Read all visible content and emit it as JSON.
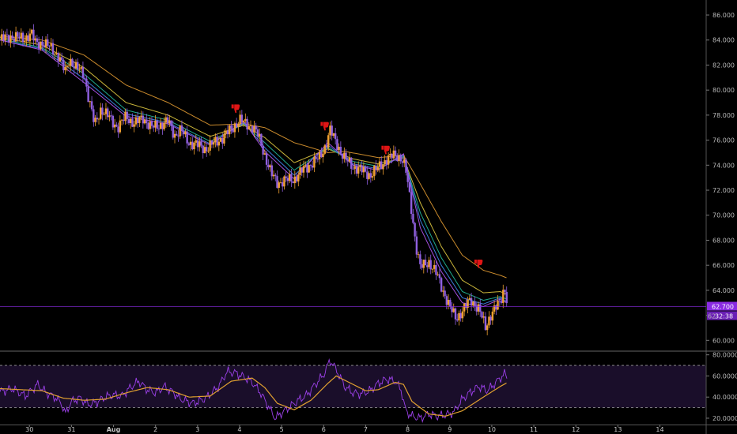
{
  "chart_data": [
    {
      "type": "candlestick",
      "ylim": [
        59.2,
        87.2
      ],
      "y_ticks": [
        "86.000",
        "84.000",
        "82.000",
        "80.000",
        "78.000",
        "76.000",
        "74.000",
        "72.000",
        "70.000",
        "68.000",
        "66.000",
        "64.000",
        "62.000",
        "60.000"
      ],
      "y_tick_values": [
        86,
        84,
        82,
        80,
        78,
        76,
        74,
        72,
        70,
        68,
        66,
        64,
        62,
        60
      ],
      "x_ticks": [
        {
          "label": "30",
          "t": 0.7
        },
        {
          "label": "31",
          "t": 1.7
        },
        {
          "label": "Aug",
          "t": 2.7,
          "bold": true
        },
        {
          "label": "2",
          "t": 3.7
        },
        {
          "label": "3",
          "t": 4.7
        },
        {
          "label": "4",
          "t": 5.7
        },
        {
          "label": "5",
          "t": 6.7
        },
        {
          "label": "6",
          "t": 7.7
        },
        {
          "label": "7",
          "t": 8.7
        },
        {
          "label": "8",
          "t": 9.7
        },
        {
          "label": "9",
          "t": 10.7
        },
        {
          "label": "10",
          "t": 11.7
        },
        {
          "label": "11",
          "t": 12.7
        },
        {
          "label": "12",
          "t": 13.7
        },
        {
          "label": "13",
          "t": 14.7
        },
        {
          "label": "14",
          "t": 15.7
        }
      ],
      "x_range": [
        0,
        16.8
      ],
      "last_price": {
        "label": "62.700",
        "value": 62.7,
        "countdown": "32:38",
        "partial": "62"
      },
      "price_path": [
        [
          0,
          84.0
        ],
        [
          0.25,
          84.3
        ],
        [
          0.55,
          84.1
        ],
        [
          0.75,
          84.5
        ],
        [
          0.85,
          83.7
        ],
        [
          1.0,
          83.8
        ],
        [
          1.2,
          83.4
        ],
        [
          1.4,
          82.7
        ],
        [
          1.55,
          81.4
        ],
        [
          1.65,
          82.5
        ],
        [
          1.8,
          81.8
        ],
        [
          2.0,
          81.3
        ],
        [
          2.1,
          79.5
        ],
        [
          2.25,
          77.2
        ],
        [
          2.4,
          78.5
        ],
        [
          2.6,
          77.8
        ],
        [
          2.8,
          77.0
        ],
        [
          3.0,
          77.9
        ],
        [
          3.2,
          77.3
        ],
        [
          3.4,
          77.8
        ],
        [
          3.6,
          77.0
        ],
        [
          3.8,
          77.2
        ],
        [
          4.0,
          77.5
        ],
        [
          4.15,
          76.4
        ],
        [
          4.3,
          76.8
        ],
        [
          4.5,
          75.8
        ],
        [
          4.7,
          75.6
        ],
        [
          4.9,
          75.3
        ],
        [
          5.1,
          75.8
        ],
        [
          5.3,
          76.2
        ],
        [
          5.5,
          76.9
        ],
        [
          5.7,
          77.6
        ],
        [
          5.85,
          77.3
        ],
        [
          6.0,
          77.1
        ],
        [
          6.15,
          76.3
        ],
        [
          6.3,
          74.8
        ],
        [
          6.45,
          73.3
        ],
        [
          6.6,
          72.6
        ],
        [
          6.8,
          72.8
        ],
        [
          7.0,
          72.9
        ],
        [
          7.2,
          73.6
        ],
        [
          7.4,
          74.1
        ],
        [
          7.6,
          74.6
        ],
        [
          7.75,
          75.6
        ],
        [
          7.85,
          76.8
        ],
        [
          8.0,
          75.8
        ],
        [
          8.2,
          74.5
        ],
        [
          8.4,
          73.9
        ],
        [
          8.6,
          73.6
        ],
        [
          8.8,
          73.2
        ],
        [
          9.0,
          73.8
        ],
        [
          9.2,
          74.5
        ],
        [
          9.4,
          74.8
        ],
        [
          9.55,
          74.6
        ],
        [
          9.65,
          73.7
        ],
        [
          9.8,
          70.2
        ],
        [
          9.9,
          67.5
        ],
        [
          10.0,
          65.8
        ],
        [
          10.2,
          66.3
        ],
        [
          10.4,
          65.2
        ],
        [
          10.55,
          63.9
        ],
        [
          10.7,
          62.6
        ],
        [
          10.85,
          61.8
        ],
        [
          11.0,
          62.3
        ],
        [
          11.2,
          63.3
        ],
        [
          11.4,
          62.4
        ],
        [
          11.55,
          61.1
        ],
        [
          11.65,
          61.9
        ],
        [
          11.8,
          62.6
        ],
        [
          11.9,
          63.1
        ],
        [
          12.0,
          64.3
        ],
        [
          12.08,
          62.8
        ]
      ],
      "ema_series": [
        {
          "color": "#c98a2c",
          "points": [
            [
              0,
              84.3
            ],
            [
              1.0,
              84.0
            ],
            [
              2.0,
              82.8
            ],
            [
              3.0,
              80.4
            ],
            [
              4.0,
              79.0
            ],
            [
              5.0,
              77.2
            ],
            [
              5.8,
              77.3
            ],
            [
              6.3,
              77.0
            ],
            [
              7.0,
              75.8
            ],
            [
              7.8,
              75.0
            ],
            [
              8.2,
              75.1
            ],
            [
              9.0,
              74.6
            ],
            [
              9.6,
              74.8
            ],
            [
              10.0,
              72.5
            ],
            [
              10.5,
              69.5
            ],
            [
              11.0,
              66.8
            ],
            [
              11.5,
              65.6
            ],
            [
              11.9,
              65.2
            ],
            [
              12.05,
              65.0
            ]
          ]
        },
        {
          "color": "#c9b53a",
          "points": [
            [
              0,
              84.2
            ],
            [
              1.0,
              83.6
            ],
            [
              2.0,
              81.8
            ],
            [
              3.0,
              79.0
            ],
            [
              4.0,
              78.0
            ],
            [
              5.0,
              76.3
            ],
            [
              5.8,
              77.2
            ],
            [
              6.3,
              76.2
            ],
            [
              7.0,
              74.2
            ],
            [
              7.8,
              75.3
            ],
            [
              8.4,
              74.5
            ],
            [
              9.0,
              74.1
            ],
            [
              9.6,
              74.6
            ],
            [
              10.0,
              71.0
            ],
            [
              10.5,
              67.5
            ],
            [
              11.0,
              64.8
            ],
            [
              11.5,
              63.8
            ],
            [
              11.9,
              63.9
            ],
            [
              12.05,
              63.7
            ]
          ]
        },
        {
          "color": "#1faa8c",
          "points": [
            [
              0,
              84.1
            ],
            [
              1.0,
              83.4
            ],
            [
              2.0,
              81.3
            ],
            [
              3.0,
              78.4
            ],
            [
              4.0,
              77.6
            ],
            [
              5.0,
              75.9
            ],
            [
              5.8,
              77.3
            ],
            [
              6.3,
              75.8
            ],
            [
              7.0,
              73.6
            ],
            [
              7.8,
              75.4
            ],
            [
              8.4,
              74.3
            ],
            [
              9.0,
              73.9
            ],
            [
              9.6,
              74.7
            ],
            [
              10.0,
              70.2
            ],
            [
              10.5,
              66.6
            ],
            [
              11.0,
              63.9
            ],
            [
              11.5,
              63.2
            ],
            [
              11.9,
              63.5
            ],
            [
              12.05,
              63.3
            ]
          ]
        },
        {
          "color": "#3b7bd9",
          "points": [
            [
              0,
              84.0
            ],
            [
              1.0,
              83.3
            ],
            [
              2.0,
              80.9
            ],
            [
              3.0,
              78.1
            ],
            [
              4.0,
              77.4
            ],
            [
              5.0,
              75.7
            ],
            [
              5.8,
              77.4
            ],
            [
              6.3,
              75.4
            ],
            [
              7.0,
              73.2
            ],
            [
              7.8,
              75.6
            ],
            [
              8.4,
              74.1
            ],
            [
              9.0,
              73.7
            ],
            [
              9.6,
              74.8
            ],
            [
              10.0,
              69.6
            ],
            [
              10.5,
              66.0
            ],
            [
              11.0,
              63.4
            ],
            [
              11.5,
              62.9
            ],
            [
              11.9,
              63.4
            ],
            [
              12.05,
              63.1
            ]
          ]
        },
        {
          "color": "#a54fe0",
          "points": [
            [
              0,
              84.0
            ],
            [
              1.0,
              83.2
            ],
            [
              2.0,
              80.6
            ],
            [
              3.0,
              77.9
            ],
            [
              4.0,
              77.3
            ],
            [
              5.0,
              75.6
            ],
            [
              5.8,
              77.5
            ],
            [
              6.3,
              75.1
            ],
            [
              7.0,
              72.9
            ],
            [
              7.8,
              75.8
            ],
            [
              8.4,
              74.0
            ],
            [
              9.0,
              73.6
            ],
            [
              9.6,
              74.9
            ],
            [
              10.0,
              69.0
            ],
            [
              10.5,
              65.5
            ],
            [
              11.0,
              63.0
            ],
            [
              11.5,
              62.7
            ],
            [
              11.9,
              63.3
            ],
            [
              12.05,
              63.0
            ]
          ]
        }
      ],
      "sell_signals": [
        {
          "t": 5.6,
          "value": 78.6
        },
        {
          "t": 7.72,
          "value": 77.2
        },
        {
          "t": 9.17,
          "value": 75.3
        },
        {
          "t": 11.38,
          "value": 66.2
        }
      ],
      "colors": {
        "bull": "#f0a030",
        "bear": "#9060e0",
        "background": "#000000",
        "grid": "#3a3a3a",
        "price_line": "#8a2be2",
        "signal": "#e01515"
      }
    },
    {
      "type": "line",
      "ylim": [
        14,
        82
      ],
      "y_ticks": [
        "80.0000",
        "60.0000",
        "40.0000",
        "20.0000"
      ],
      "y_tick_values": [
        80,
        60,
        40,
        20
      ],
      "band": [
        30,
        70
      ],
      "series": [
        {
          "color": "#9b40e8",
          "points": [
            [
              0,
              45
            ],
            [
              0.3,
              48
            ],
            [
              0.6,
              41
            ],
            [
              0.9,
              52
            ],
            [
              1.1,
              44
            ],
            [
              1.3,
              40
            ],
            [
              1.45,
              35
            ],
            [
              1.55,
              24
            ],
            [
              1.7,
              36
            ],
            [
              1.9,
              39
            ],
            [
              2.1,
              33
            ],
            [
              2.3,
              35
            ],
            [
              2.5,
              40
            ],
            [
              2.7,
              42
            ],
            [
              2.9,
              41
            ],
            [
              3.1,
              49
            ],
            [
              3.3,
              55
            ],
            [
              3.5,
              47
            ],
            [
              3.7,
              44
            ],
            [
              3.9,
              50
            ],
            [
              4.1,
              45
            ],
            [
              4.3,
              38
            ],
            [
              4.6,
              34
            ],
            [
              4.9,
              39
            ],
            [
              5.2,
              50
            ],
            [
              5.4,
              64
            ],
            [
              5.6,
              63
            ],
            [
              5.8,
              59
            ],
            [
              6.0,
              54
            ],
            [
              6.2,
              44
            ],
            [
              6.4,
              30
            ],
            [
              6.55,
              20
            ],
            [
              6.7,
              25
            ],
            [
              6.9,
              31
            ],
            [
              7.1,
              37
            ],
            [
              7.3,
              42
            ],
            [
              7.5,
              52
            ],
            [
              7.7,
              61
            ],
            [
              7.85,
              75
            ],
            [
              8.0,
              66
            ],
            [
              8.2,
              50
            ],
            [
              8.4,
              44
            ],
            [
              8.6,
              43
            ],
            [
              8.8,
              46
            ],
            [
              9.0,
              53
            ],
            [
              9.2,
              57
            ],
            [
              9.4,
              55
            ],
            [
              9.55,
              46
            ],
            [
              9.65,
              27
            ],
            [
              9.8,
              22
            ],
            [
              10.0,
              20
            ],
            [
              10.2,
              24
            ],
            [
              10.4,
              22
            ],
            [
              10.6,
              23
            ],
            [
              10.8,
              26
            ],
            [
              11.0,
              38
            ],
            [
              11.2,
              45
            ],
            [
              11.4,
              50
            ],
            [
              11.6,
              46
            ],
            [
              11.8,
              54
            ],
            [
              12.0,
              62
            ],
            [
              12.08,
              58
            ]
          ]
        },
        {
          "color": "#e0a030",
          "points": [
            [
              0,
              48
            ],
            [
              0.5,
              47
            ],
            [
              1.0,
              46
            ],
            [
              1.5,
              39
            ],
            [
              2.0,
              37
            ],
            [
              2.5,
              38
            ],
            [
              3.0,
              44
            ],
            [
              3.5,
              49
            ],
            [
              4.0,
              47
            ],
            [
              4.5,
              40
            ],
            [
              5.0,
              41
            ],
            [
              5.5,
              55
            ],
            [
              6.0,
              58
            ],
            [
              6.3,
              49
            ],
            [
              6.6,
              34
            ],
            [
              7.0,
              28
            ],
            [
              7.4,
              37
            ],
            [
              7.8,
              53
            ],
            [
              8.0,
              60
            ],
            [
              8.3,
              54
            ],
            [
              8.7,
              46
            ],
            [
              9.0,
              47
            ],
            [
              9.4,
              54
            ],
            [
              9.6,
              52
            ],
            [
              9.8,
              36
            ],
            [
              10.2,
              24
            ],
            [
              10.6,
              22
            ],
            [
              11.0,
              27
            ],
            [
              11.5,
              40
            ],
            [
              11.9,
              50
            ],
            [
              12.08,
              54
            ]
          ]
        }
      ],
      "colors": {
        "band_fill": "#1a0e2a",
        "band_line": "#9a9a9a"
      }
    }
  ]
}
